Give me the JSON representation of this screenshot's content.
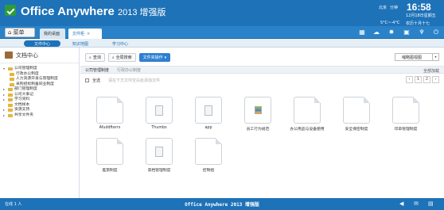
{
  "header": {
    "app_name": "Office Anywhere",
    "version": "2013 增强版",
    "user_location": "北京",
    "user_name": "分钟",
    "clock": "16:58",
    "date": "12月18日星期五",
    "weather": "5°C~-4°C",
    "lunar": "农历十月十七"
  },
  "nav": {
    "menu_label": "菜单",
    "tabs": [
      {
        "label": "我的桌面"
      },
      {
        "label": "文件柜"
      }
    ],
    "icons": [
      "grid-icon",
      "cloud-icon",
      "settings-icon",
      "clipboard-icon",
      "pin-icon",
      "power-icon"
    ]
  },
  "subnav": {
    "items": [
      "文件中心",
      "知识地图",
      "学习中心"
    ]
  },
  "sidebar": {
    "title": "文档中心",
    "items": [
      {
        "label": "公司管理制度",
        "level": 0,
        "arrow": "▾"
      },
      {
        "label": "行政办公制度",
        "level": 1,
        "arrow": ""
      },
      {
        "label": "人力资源开发与管理制度",
        "level": 1,
        "arrow": ""
      },
      {
        "label": "采购招标制备同业制度",
        "level": 1,
        "arrow": ""
      },
      {
        "label": "部门管理制度",
        "level": 0,
        "arrow": "▸"
      },
      {
        "label": "公司大事记",
        "level": 0,
        "arrow": "▸"
      },
      {
        "label": "学习资料",
        "level": 0,
        "arrow": "▸"
      },
      {
        "label": "文档样本",
        "level": 0,
        "arrow": ""
      },
      {
        "label": "资源支持",
        "level": 0,
        "arrow": "▸"
      },
      {
        "label": "共享文件夹",
        "level": 0,
        "arrow": "▸"
      }
    ]
  },
  "toolbar": {
    "query_label": "查询",
    "fulltext_label": "全局搜索",
    "folder_ops_label": "文件夹操作"
  },
  "view_select": "缩略图视图",
  "breadcrumb": {
    "current": "公司管理制度",
    "path": "行政办公制度",
    "right_text": "全部加载"
  },
  "selbar": {
    "select_all": "全选",
    "hint": "请在下方文件空白处添加文件"
  },
  "pager": [
    "‹",
    "1",
    "2",
    "›"
  ],
  "files": [
    {
      "name": "Afuddfterrs",
      "icon": "folder-doc"
    },
    {
      "name": "Thumbs",
      "icon": "file"
    },
    {
      "name": "app",
      "icon": "file"
    },
    {
      "name": "员工行为规范",
      "icon": "image"
    },
    {
      "name": "办公用品与设备使用",
      "icon": "folder-doc"
    },
    {
      "name": "安全保密制度",
      "icon": "folder-doc"
    },
    {
      "name": "印章管理制度",
      "icon": "folder-doc"
    },
    {
      "name": "差旅制度",
      "icon": "folder-doc"
    },
    {
      "name": "高档管理制度",
      "icon": "file"
    },
    {
      "name": "控制组",
      "icon": "folder-doc"
    }
  ],
  "footer": {
    "online": "在线 1 人",
    "title": "Office Anywhere 2013 增强版"
  }
}
